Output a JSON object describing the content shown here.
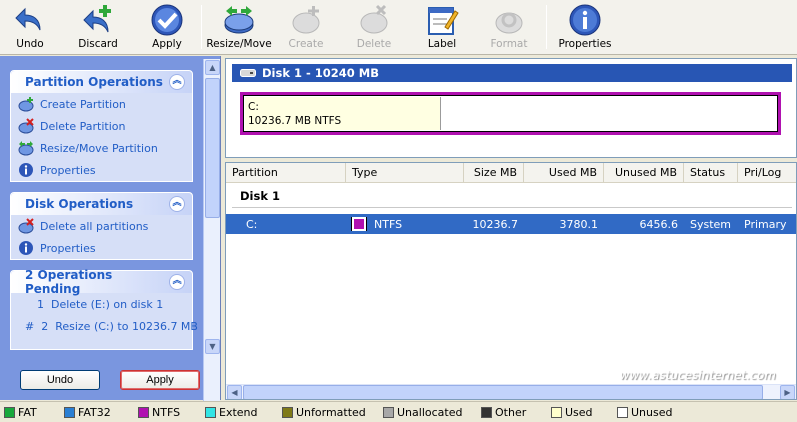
{
  "toolbar": {
    "undo": "Undo",
    "discard": "Discard",
    "apply": "Apply",
    "resize_move": "Resize/Move",
    "create": "Create",
    "delete": "Delete",
    "label": "Label",
    "format": "Format",
    "properties": "Properties"
  },
  "sidebar": {
    "partition_ops": {
      "title": "Partition Operations",
      "items": [
        "Create Partition",
        "Delete Partition",
        "Resize/Move Partition",
        "Properties"
      ]
    },
    "disk_ops": {
      "title": "Disk Operations",
      "items": [
        "Delete all partitions",
        "Properties"
      ]
    },
    "pending": {
      "title": "2 Operations Pending",
      "items": [
        "1  Delete (E:) on disk 1",
        "#  2  Resize (C:) to 10236.7 MB"
      ]
    },
    "undo_button": "Undo",
    "apply_button": "Apply"
  },
  "disk_map": {
    "header": "Disk 1 - 10240 MB",
    "partition_letter": "C:",
    "partition_info": "10236.7 MB  NTFS",
    "used_fraction": 0.37
  },
  "list": {
    "columns": [
      "Partition",
      "Type",
      "Size MB",
      "Used MB",
      "Unused MB",
      "Status",
      "Pri/Log"
    ],
    "group": "Disk 1",
    "row": {
      "partition": "C:",
      "type": "NTFS",
      "size": "10236.7",
      "used": "3780.1",
      "unused": "6456.6",
      "status": "System",
      "pri_log": "Primary"
    }
  },
  "watermark": "www.astucesinternet.com",
  "legend": [
    {
      "label": "FAT",
      "color": "#18a83c"
    },
    {
      "label": "FAT32",
      "color": "#2a7fd4"
    },
    {
      "label": "NTFS",
      "color": "#b011b0"
    },
    {
      "label": "Extend",
      "color": "#33e5e5"
    },
    {
      "label": "Unformatted",
      "color": "#7f7a18"
    },
    {
      "label": "Unallocated",
      "color": "#a8a8a8"
    },
    {
      "label": "Other",
      "color": "#333333"
    },
    {
      "label": "Used",
      "color": "#ffffcc"
    },
    {
      "label": "Unused",
      "color": "#ffffff"
    }
  ]
}
